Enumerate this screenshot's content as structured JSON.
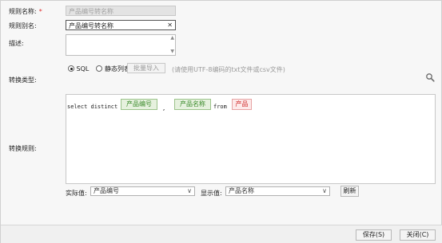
{
  "form": {
    "rule_name_label": "规则名称:",
    "rule_name_required": "*",
    "rule_name_value": "产品编号转名称",
    "rule_alias_label": "规则别名:",
    "rule_alias_value": "产品编号转名称",
    "description_label": "描述:",
    "convert_type_label": "转换类型:",
    "convert_rule_label": "转换规则:"
  },
  "convert_type": {
    "options": [
      "SQL",
      "静态列表"
    ],
    "selected": "SQL",
    "batch_import_label": "批量导入",
    "hint": "(请使用UTF-8编码的txt文件或csv文件)"
  },
  "rule_expression": {
    "select_kw": "select distinct",
    "field1": "产品编号",
    "comma": ",",
    "field2": "产品名称",
    "from_kw": "from",
    "table": "产品"
  },
  "bottom_bar": {
    "actual_label": "实际值:",
    "actual_value": "产品编号",
    "display_label": "显示值:",
    "display_value": "产品名称",
    "refresh_label": "刷新"
  },
  "footer": {
    "save_label": "保存(S)",
    "close_label": "关闭(C)"
  }
}
